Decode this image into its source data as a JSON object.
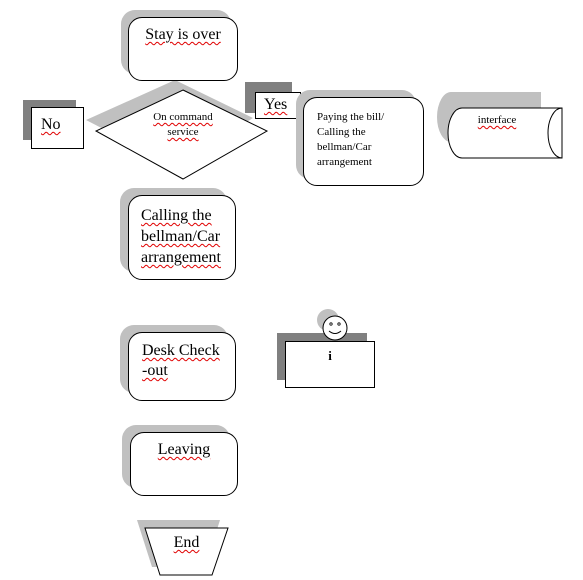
{
  "nodes": {
    "stay": "Stay is over",
    "decision": "On command service",
    "no": "No",
    "yes": "Yes",
    "paying": "Paying the bill/ Calling the bellman/Car arrangement",
    "interface": "interface",
    "calling": "Calling the bellman/Car arrangement",
    "desk": "Desk Check -out",
    "actor": "i",
    "leaving": "Leaving",
    "end": "End"
  },
  "colors": {
    "shadow_light": "#c0c0c0",
    "shadow_dark": "#808080",
    "spellcheck": "#e00000"
  }
}
